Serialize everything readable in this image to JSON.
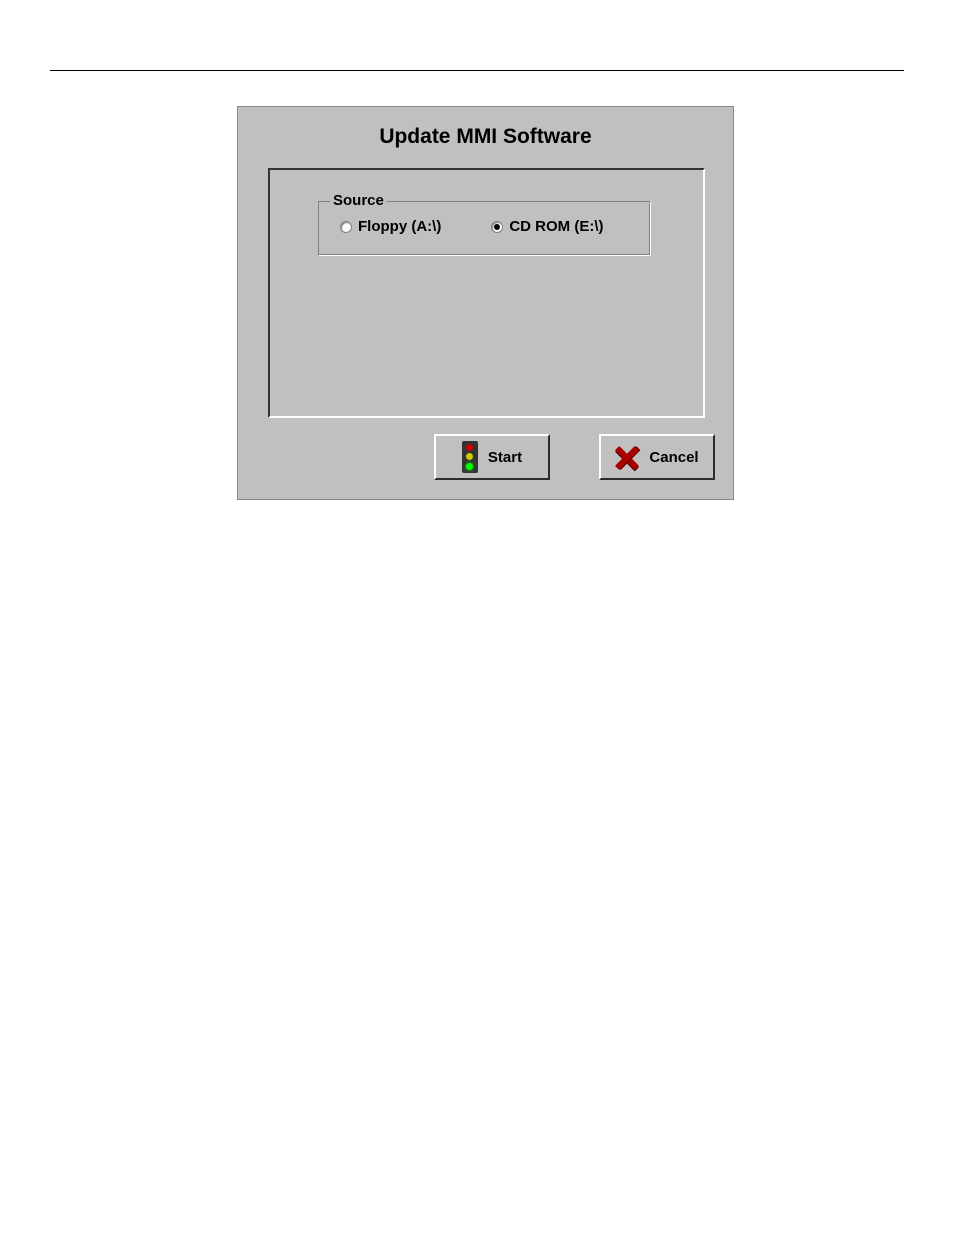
{
  "dialog": {
    "title": "Update MMI Software",
    "source": {
      "legend": "Source",
      "options": [
        {
          "label": "Floppy (A:\\)",
          "selected": false
        },
        {
          "label": "CD ROM (E:\\)",
          "selected": true
        }
      ]
    },
    "buttons": {
      "start": "Start",
      "cancel": "Cancel"
    }
  }
}
